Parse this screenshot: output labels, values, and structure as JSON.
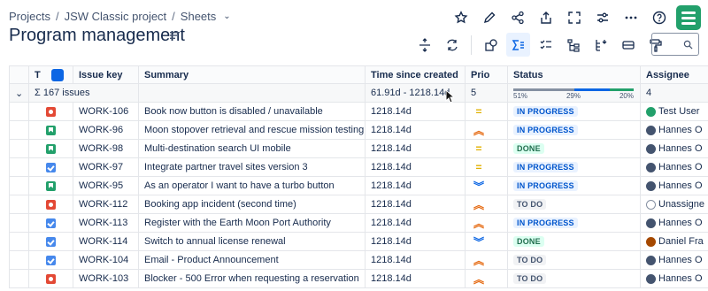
{
  "breadcrumb": {
    "projects": "Projects",
    "project": "JSW Classic project",
    "section": "Sheets"
  },
  "page": {
    "title": "Program management"
  },
  "search": {
    "placeholder": ""
  },
  "columns": {
    "type": "T",
    "key": "Issue key",
    "summary": "Summary",
    "time": "Time since created",
    "prio": "Prio",
    "status": "Status",
    "assignee": "Assignee"
  },
  "group": {
    "sigma": "Σ",
    "count": "167 issues",
    "time_range": "61.91d - 1218.14d",
    "prio_count": "5",
    "status_pcts": [
      "51%",
      "29%",
      "20%"
    ],
    "status_fractions": [
      0.51,
      0.29,
      0.2
    ],
    "assignee_count": "4"
  },
  "rows": [
    {
      "type": "bug",
      "key": "WORK-106",
      "summary": "Book now button is disabled / unavailable",
      "time": "1218.14d",
      "prio": "medium",
      "status": "IN PROGRESS",
      "status_kind": "progress",
      "assignee": "Test User",
      "avatar": "green"
    },
    {
      "type": "story",
      "key": "WORK-96",
      "summary": "Moon stopover retrieval and rescue mission testing",
      "time": "1218.14d",
      "prio": "high",
      "status": "IN PROGRESS",
      "status_kind": "progress",
      "assignee": "Hannes O",
      "avatar": "dark"
    },
    {
      "type": "story",
      "key": "WORK-98",
      "summary": "Multi-destination search UI mobile",
      "time": "1218.14d",
      "prio": "medium",
      "status": "DONE",
      "status_kind": "done",
      "assignee": "Hannes O",
      "avatar": "dark"
    },
    {
      "type": "task",
      "key": "WORK-97",
      "summary": "Integrate partner travel sites version 3",
      "time": "1218.14d",
      "prio": "medium",
      "status": "IN PROGRESS",
      "status_kind": "progress",
      "assignee": "Hannes O",
      "avatar": "dark"
    },
    {
      "type": "story",
      "key": "WORK-95",
      "summary": "As an operator I want to have a turbo button",
      "time": "1218.14d",
      "prio": "low",
      "status": "IN PROGRESS",
      "status_kind": "progress",
      "assignee": "Hannes O",
      "avatar": "dark"
    },
    {
      "type": "bug",
      "key": "WORK-112",
      "summary": "Booking app incident (second time)",
      "time": "1218.14d",
      "prio": "high",
      "status": "TO DO",
      "status_kind": "todo",
      "assignee": "Unassigne",
      "avatar": "empty"
    },
    {
      "type": "task",
      "key": "WORK-113",
      "summary": "Register with the Earth Moon Port Authority",
      "time": "1218.14d",
      "prio": "high",
      "status": "IN PROGRESS",
      "status_kind": "progress",
      "assignee": "Hannes O",
      "avatar": "dark"
    },
    {
      "type": "task",
      "key": "WORK-114",
      "summary": "Switch to annual license renewal",
      "time": "1218.14d",
      "prio": "low",
      "status": "DONE",
      "status_kind": "done",
      "assignee": "Daniel Fra",
      "avatar": "brown"
    },
    {
      "type": "task",
      "key": "WORK-104",
      "summary": "Email - Product Announcement",
      "time": "1218.14d",
      "prio": "high",
      "status": "TO DO",
      "status_kind": "todo",
      "assignee": "Hannes O",
      "avatar": "dark"
    },
    {
      "type": "bug",
      "key": "WORK-103",
      "summary": "Blocker - 500 Error when requesting a reservation",
      "time": "1218.14d",
      "prio": "high",
      "status": "TO DO",
      "status_kind": "todo",
      "assignee": "Hannes O",
      "avatar": "dark"
    }
  ]
}
